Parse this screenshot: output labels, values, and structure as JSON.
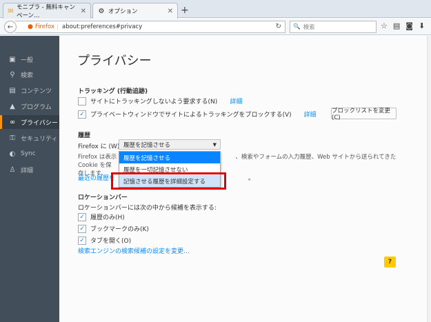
{
  "tabs": [
    {
      "title": "モニプラ - 無料キャンペーン…",
      "icon": "monipla-icon"
    },
    {
      "title": "オプション",
      "icon": "gear-icon"
    }
  ],
  "nav": {
    "identity": "Firefox",
    "url": "about:preferences#privacy",
    "search_placeholder": "検索"
  },
  "sidebar": {
    "items": [
      {
        "label": "一般",
        "icon": "general-icon"
      },
      {
        "label": "検索",
        "icon": "search-icon"
      },
      {
        "label": "コンテンツ",
        "icon": "content-icon"
      },
      {
        "label": "プログラム",
        "icon": "applications-icon"
      },
      {
        "label": "プライバシー",
        "icon": "privacy-mask-icon",
        "active": true
      },
      {
        "label": "セキュリティ",
        "icon": "security-lock-icon"
      },
      {
        "label": "Sync",
        "icon": "sync-icon"
      },
      {
        "label": "詳細",
        "icon": "advanced-icon"
      }
    ]
  },
  "main": {
    "title": "プライバシー",
    "tracking": {
      "heading": "トラッキング (行動追跡)",
      "dnt_label": "サイトにトラッキングしないよう要求する(N)",
      "dnt_checked": false,
      "dnt_more": "詳細",
      "pb_label": "プライベートウィンドウでサイトによるトラッキングをブロックする(V)",
      "pb_checked": true,
      "pb_more": "詳細",
      "blocklist_button": "ブロックリストを変更(C)"
    },
    "history": {
      "heading": "履歴",
      "firefox_will": "Firefox に (W)",
      "select_value": "履歴を記憶させる",
      "desc_left": "Firefox は表示",
      "desc_right": "、検索やフォームの入力履歴、Web サイトから送られてきた Cookie を保",
      "desc_line2": "存します。",
      "clear_link": "最近の履歴を",
      "clear_link_tail": "。",
      "options": [
        "履歴を記憶させる",
        "履歴を一切記憶させない",
        "記憶させる履歴を詳細設定する"
      ]
    },
    "location": {
      "heading": "ロケーションバー",
      "intro": "ロケーションバーには次の中から候補を表示する:",
      "opt_history": "履歴のみ(H)",
      "opt_bookmarks": "ブックマークのみ(K)",
      "opt_tabs": "タブを開く(O)",
      "search_link": "検索エンジンの検索候補の設定を変更…"
    },
    "help": "?"
  }
}
